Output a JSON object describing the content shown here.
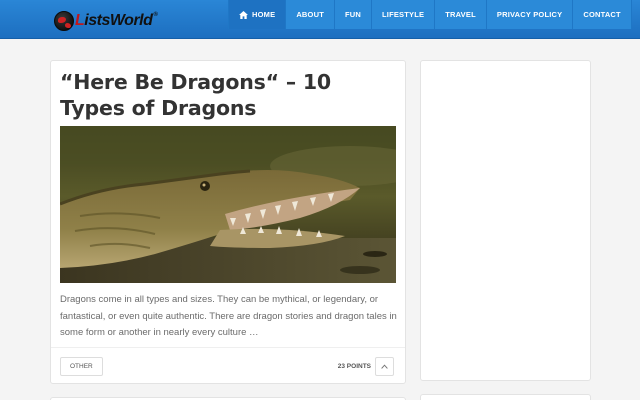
{
  "header": {
    "logo": {
      "prefix": "L",
      "rest": "istsWorld",
      "reg": "®"
    },
    "nav": [
      {
        "label": "HOME",
        "icon": "home-icon"
      },
      {
        "label": "ABOUT"
      },
      {
        "label": "FUN"
      },
      {
        "label": "LIFESTYLE"
      },
      {
        "label": "TRAVEL"
      },
      {
        "label": "PRIVACY POLICY"
      },
      {
        "label": "CONTACT"
      }
    ]
  },
  "article": {
    "title": "“Here Be Dragons“ – 10 Types of Dragons",
    "excerpt": "Dragons come in all types and sizes. They can be mythical, or legendary, or fantastical, or even quite authentic. There are dragon stories and dragon tales in some form or another in nearly every culture …",
    "category": "OTHER",
    "points": "23 POINTS",
    "vote_icon": "chevron-up-icon"
  },
  "colors": {
    "header_blue": "#2a86d6",
    "logo_red": "#c0171b"
  }
}
